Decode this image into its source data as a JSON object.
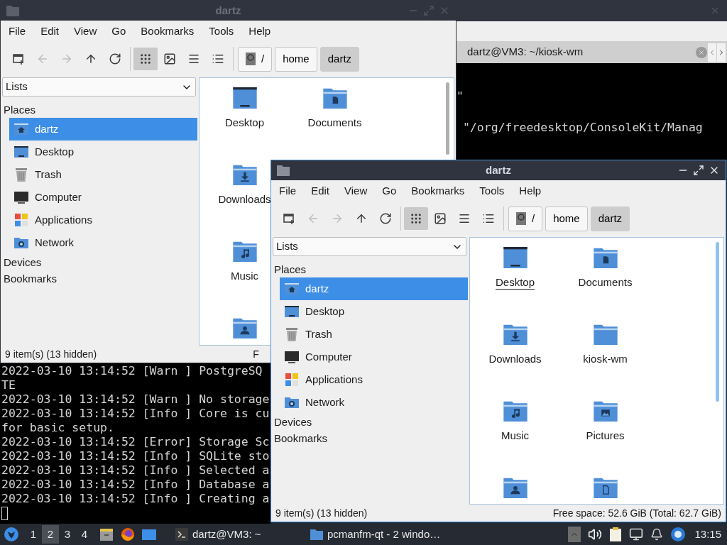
{
  "file_manager_windows": [
    {
      "title": "dartz",
      "active": false,
      "menu": [
        "File",
        "Edit",
        "View",
        "Go",
        "Bookmarks",
        "Tools",
        "Help"
      ],
      "toolbar": [
        {
          "kind": "new_tab",
          "disabled": false,
          "selected": false
        },
        {
          "kind": "back",
          "disabled": true,
          "selected": false
        },
        {
          "kind": "forward",
          "disabled": true,
          "selected": false
        },
        {
          "kind": "up",
          "disabled": false,
          "selected": false
        },
        {
          "kind": "reload",
          "disabled": false,
          "selected": false
        },
        {
          "kind": "separator"
        },
        {
          "kind": "icon_view",
          "disabled": false,
          "selected": true
        },
        {
          "kind": "thumbnail_view",
          "disabled": false,
          "selected": false
        },
        {
          "kind": "compact_view",
          "disabled": false,
          "selected": false
        },
        {
          "kind": "detail_view",
          "disabled": false,
          "selected": false
        }
      ],
      "path": [
        {
          "label": "/",
          "kind": "root",
          "selected": false
        },
        {
          "label": "home",
          "kind": "dir",
          "selected": false
        },
        {
          "label": "dartz",
          "kind": "dir",
          "selected": true
        }
      ],
      "side_pane_mode": "Lists",
      "places_header": "Places",
      "places": [
        {
          "label": "dartz",
          "kind": "home",
          "selected": true
        },
        {
          "label": "Desktop",
          "kind": "desktop",
          "selected": false
        },
        {
          "label": "Trash",
          "kind": "trash",
          "selected": false
        },
        {
          "label": "Computer",
          "kind": "computer",
          "selected": false
        },
        {
          "label": "Applications",
          "kind": "applications",
          "selected": false
        },
        {
          "label": "Network",
          "kind": "network",
          "selected": false
        }
      ],
      "sections": [
        "Devices",
        "Bookmarks"
      ],
      "icon_rows": [
        [
          {
            "label": "Desktop",
            "kind": "desktop",
            "focused": false
          },
          {
            "label": "Documents",
            "kind": "documents",
            "focused": false
          }
        ],
        [
          {
            "label": "Downloads",
            "kind": "downloads",
            "focused": false
          }
        ],
        [
          {
            "label": "Music",
            "kind": "music",
            "focused": false
          }
        ],
        [
          {
            "kind": "public"
          }
        ]
      ],
      "status_left": "9 item(s) (13 hidden)",
      "status_right": "F"
    },
    {
      "title": "dartz",
      "active": true,
      "menu": [
        "File",
        "Edit",
        "View",
        "Go",
        "Bookmarks",
        "Tools",
        "Help"
      ],
      "toolbar": [
        {
          "kind": "new_tab",
          "disabled": false,
          "selected": false
        },
        {
          "kind": "back",
          "disabled": true,
          "selected": false
        },
        {
          "kind": "forward",
          "disabled": true,
          "selected": false
        },
        {
          "kind": "up",
          "disabled": false,
          "selected": false
        },
        {
          "kind": "reload",
          "disabled": false,
          "selected": false
        },
        {
          "kind": "separator"
        },
        {
          "kind": "icon_view",
          "disabled": false,
          "selected": true
        },
        {
          "kind": "thumbnail_view",
          "disabled": false,
          "selected": false
        },
        {
          "kind": "compact_view",
          "disabled": false,
          "selected": false
        },
        {
          "kind": "detail_view",
          "disabled": false,
          "selected": false
        }
      ],
      "path": [
        {
          "label": "/",
          "kind": "root",
          "selected": false
        },
        {
          "label": "home",
          "kind": "dir",
          "selected": false
        },
        {
          "label": "dartz",
          "kind": "dir",
          "selected": true
        }
      ],
      "side_pane_mode": "Lists",
      "places_header": "Places",
      "places": [
        {
          "label": "dartz",
          "kind": "home",
          "selected": true
        },
        {
          "label": "Desktop",
          "kind": "desktop",
          "selected": false
        },
        {
          "label": "Trash",
          "kind": "trash",
          "selected": false
        },
        {
          "label": "Computer",
          "kind": "computer",
          "selected": false
        },
        {
          "label": "Applications",
          "kind": "applications",
          "selected": false
        },
        {
          "label": "Network",
          "kind": "network",
          "selected": false
        }
      ],
      "sections": [
        "Devices",
        "Bookmarks"
      ],
      "icon_rows": [
        [
          {
            "label": "Desktop",
            "kind": "desktop",
            "focused": true
          },
          {
            "label": "Documents",
            "kind": "documents",
            "focused": false
          }
        ],
        [
          {
            "label": "Downloads",
            "kind": "downloads",
            "focused": false
          },
          {
            "label": "kiosk-wm",
            "kind": "folder",
            "focused": false
          }
        ],
        [
          {
            "label": "Music",
            "kind": "music",
            "focused": false
          },
          {
            "label": "Pictures",
            "kind": "pictures",
            "focused": false
          }
        ],
        [
          {
            "kind": "public"
          },
          {
            "kind": "templates"
          }
        ]
      ],
      "status_left": "9 item(s) (13 hidden)",
      "status_right": "Free space: 52.6 GiB (Total: 62.7 GiB)"
    }
  ],
  "terminal_window": {
    "tab_title": "dartz@VM3: ~/kiosk-wm",
    "lines": [
      "\"",
      "\"/org/freedesktop/ConsoleKit/Manag"
    ]
  },
  "log_terminal": {
    "lines": [
      "2022-03-10 13:14:52 [Warn ] PostgreSQ",
      "TE",
      "2022-03-10 13:14:52 [Warn ] No storage",
      "2022-03-10 13:14:52 [Info ] Core is cu",
      "for basic setup.",
      "2022-03-10 13:14:52 [Error] Storage Sc",
      "2022-03-10 13:14:52 [Info ] SQLite sto",
      "2022-03-10 13:14:52 [Info ] Selected a",
      "2022-03-10 13:14:52 [Info ] Database a",
      "2022-03-10 13:14:52 [Info ] Creating a"
    ]
  },
  "taskbar": {
    "workspaces": [
      {
        "label": "1",
        "selected": false
      },
      {
        "label": "2",
        "selected": true
      },
      {
        "label": "3",
        "selected": false
      },
      {
        "label": "4",
        "selected": false
      }
    ],
    "launchers": [
      {
        "kind": "files"
      },
      {
        "kind": "browser"
      },
      {
        "kind": "desktop"
      }
    ],
    "tasks": [
      {
        "label": "dartz@VM3: ~",
        "kind": "terminal"
      },
      {
        "label": "pcmanfm-qt - 2 windo…",
        "kind": "folder"
      }
    ],
    "tray": [
      {
        "kind": "expand"
      },
      {
        "kind": "volume"
      },
      {
        "kind": "clipboard"
      },
      {
        "kind": "network"
      },
      {
        "kind": "notification"
      },
      {
        "kind": "update"
      }
    ],
    "clock": "13:15"
  }
}
